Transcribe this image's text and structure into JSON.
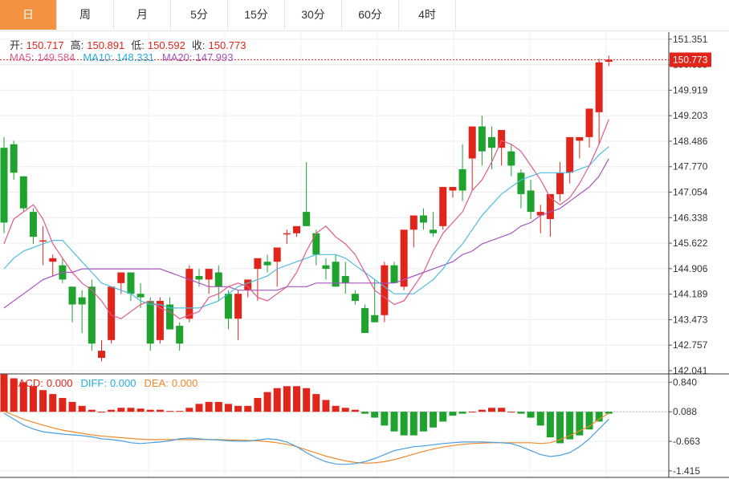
{
  "tabs": [
    {
      "label": "日",
      "active": true
    },
    {
      "label": "周",
      "active": false
    },
    {
      "label": "月",
      "active": false
    },
    {
      "label": "5分",
      "active": false
    },
    {
      "label": "15分",
      "active": false
    },
    {
      "label": "30分",
      "active": false
    },
    {
      "label": "60分",
      "active": false
    },
    {
      "label": "4时",
      "active": false
    }
  ],
  "ohlc": {
    "open_label": "开:",
    "open": "150.717",
    "high_label": "高:",
    "high": "150.891",
    "low_label": "低:",
    "low": "150.592",
    "close_label": "收:",
    "close": "150.773"
  },
  "ma": {
    "ma5_label": "MA5:",
    "ma5": "149.584",
    "ma10_label": "MA10:",
    "ma10": "148.331",
    "ma20_label": "MA20:",
    "ma20": "147.993"
  },
  "macd": {
    "macd_label": "MACD:",
    "macd": "0.000",
    "diff_label": "DIFF:",
    "diff": "0.000",
    "dea_label": "DEA:",
    "dea": "0.000"
  },
  "colors": {
    "up": "#e0251b",
    "down": "#1fa22e",
    "ma5": "#e05a8a",
    "ma10": "#4cbde0",
    "ma20": "#a555c0",
    "diff": "#4a9fe0",
    "dea": "#f08a2a",
    "accent": "#f39240"
  },
  "chart_data": [
    {
      "type": "candlestick",
      "y_ticks": [
        "151.351",
        "150.635",
        "149.919",
        "149.203",
        "148.486",
        "147.770",
        "147.054",
        "146.338",
        "145.622",
        "144.906",
        "144.189",
        "143.473",
        "142.757",
        "142.041"
      ],
      "ylim": [
        141.95,
        151.55
      ],
      "last_price": "150.773",
      "candles": [
        [
          148.3,
          148.6,
          145.9,
          146.2
        ],
        [
          148.4,
          148.5,
          147.4,
          147.6
        ],
        [
          147.5,
          147.5,
          146.5,
          146.6
        ],
        [
          146.5,
          146.6,
          145.6,
          145.8
        ],
        [
          145.7,
          146.1,
          145.0,
          145.7
        ],
        [
          145.1,
          145.3,
          144.7,
          145.2
        ],
        [
          145.0,
          145.2,
          144.5,
          144.6
        ],
        [
          144.4,
          144.4,
          143.4,
          143.9
        ],
        [
          144.1,
          144.3,
          143.1,
          143.9
        ],
        [
          144.4,
          144.6,
          142.6,
          142.8
        ],
        [
          142.4,
          142.9,
          142.3,
          142.6
        ],
        [
          142.9,
          144.3,
          142.8,
          144.4
        ],
        [
          144.5,
          144.6,
          144.2,
          144.8
        ],
        [
          144.8,
          144.8,
          144.0,
          144.2
        ],
        [
          144.2,
          144.5,
          143.8,
          144.1
        ],
        [
          144.0,
          144.1,
          142.6,
          142.8
        ],
        [
          142.9,
          144.1,
          142.8,
          144.0
        ],
        [
          143.9,
          144.1,
          143.2,
          143.2
        ],
        [
          143.3,
          143.4,
          142.6,
          142.8
        ],
        [
          143.5,
          145.0,
          143.4,
          144.9
        ],
        [
          144.7,
          144.9,
          144.4,
          144.6
        ],
        [
          144.6,
          144.9,
          144.2,
          144.9
        ],
        [
          144.8,
          145.0,
          144.0,
          144.4
        ],
        [
          144.2,
          144.3,
          143.2,
          143.5
        ],
        [
          143.5,
          144.3,
          142.9,
          144.2
        ],
        [
          144.3,
          144.6,
          144.1,
          144.6
        ],
        [
          144.9,
          145.0,
          144.0,
          145.2
        ],
        [
          145.1,
          145.3,
          144.8,
          145.0
        ],
        [
          145.1,
          145.3,
          144.4,
          145.5
        ],
        [
          145.9,
          146.0,
          145.6,
          145.9
        ],
        [
          145.9,
          146.1,
          145.8,
          146.1
        ],
        [
          146.5,
          147.9,
          146.3,
          146.1
        ],
        [
          145.9,
          146.0,
          145.0,
          145.3
        ],
        [
          145.0,
          145.2,
          144.6,
          144.9
        ],
        [
          145.1,
          145.3,
          144.6,
          144.4
        ],
        [
          144.7,
          145.1,
          144.2,
          144.5
        ],
        [
          144.2,
          144.3,
          143.9,
          144.0
        ],
        [
          143.8,
          143.9,
          143.1,
          143.1
        ],
        [
          143.6,
          144.6,
          143.4,
          143.4
        ],
        [
          143.6,
          145.1,
          143.4,
          145.0
        ],
        [
          145.0,
          145.1,
          144.6,
          144.5
        ],
        [
          144.4,
          145.8,
          144.3,
          146.0
        ],
        [
          146.0,
          146.4,
          145.5,
          146.4
        ],
        [
          146.4,
          146.6,
          146.0,
          146.2
        ],
        [
          146.0,
          146.5,
          145.8,
          145.9
        ],
        [
          146.1,
          147.2,
          146.0,
          147.2
        ],
        [
          147.1,
          147.1,
          146.9,
          147.2
        ],
        [
          147.7,
          148.4,
          146.8,
          147.1
        ],
        [
          148.0,
          148.0,
          147.1,
          148.9
        ],
        [
          148.9,
          149.2,
          147.8,
          148.2
        ],
        [
          148.6,
          148.9,
          147.7,
          148.3
        ],
        [
          148.3,
          148.6,
          147.8,
          148.8
        ],
        [
          148.2,
          148.4,
          147.5,
          147.8
        ],
        [
          147.6,
          147.7,
          146.6,
          147.0
        ],
        [
          147.1,
          147.4,
          146.3,
          146.5
        ],
        [
          146.4,
          146.7,
          145.9,
          146.5
        ],
        [
          146.3,
          146.9,
          145.8,
          147.0
        ],
        [
          147.0,
          147.9,
          146.8,
          147.6
        ],
        [
          147.6,
          148.4,
          147.3,
          148.6
        ],
        [
          148.5,
          148.6,
          148.0,
          148.6
        ],
        [
          148.6,
          149.4,
          148.3,
          149.4
        ],
        [
          149.3,
          150.8,
          148.4,
          150.7
        ],
        [
          150.717,
          150.891,
          150.592,
          150.773
        ]
      ],
      "ma5": [
        145.6,
        146.3,
        146.5,
        146.7,
        146.3,
        145.6,
        145.2,
        144.8,
        144.5,
        144.3,
        144.0,
        143.6,
        143.5,
        143.7,
        143.9,
        144.0,
        143.8,
        143.7,
        143.5,
        143.6,
        143.7,
        144.1,
        144.2,
        144.4,
        144.5,
        144.4,
        144.1,
        144.0,
        144.2,
        144.4,
        144.8,
        145.4,
        145.9,
        146.1,
        145.8,
        145.6,
        145.3,
        144.8,
        144.3,
        144.1,
        143.9,
        144.0,
        144.4,
        144.8,
        145.4,
        145.9,
        146.2,
        146.5,
        147.1,
        147.4,
        147.9,
        148.5,
        148.4,
        148.2,
        147.8,
        147.4,
        146.9,
        146.7,
        146.9,
        147.3,
        147.8,
        148.4,
        149.1
      ],
      "ma10": [
        144.9,
        145.2,
        145.4,
        145.5,
        145.6,
        145.7,
        145.7,
        145.4,
        145.1,
        144.8,
        144.5,
        144.4,
        144.3,
        144.2,
        144.0,
        143.9,
        143.9,
        143.8,
        143.8,
        143.8,
        143.8,
        143.9,
        144.0,
        144.2,
        144.4,
        144.5,
        144.6,
        144.7,
        144.9,
        145.0,
        145.1,
        145.2,
        145.3,
        145.3,
        145.3,
        145.2,
        145.0,
        144.8,
        144.6,
        144.4,
        144.2,
        144.2,
        144.2,
        144.4,
        144.6,
        144.9,
        145.3,
        145.6,
        146.0,
        146.4,
        146.7,
        147.0,
        147.2,
        147.4,
        147.5,
        147.6,
        147.6,
        147.6,
        147.6,
        147.7,
        147.8,
        148.1,
        148.331
      ],
      "ma20": [
        143.8,
        144.0,
        144.2,
        144.4,
        144.6,
        144.7,
        144.8,
        144.8,
        144.9,
        144.9,
        144.9,
        144.9,
        144.9,
        144.9,
        144.9,
        144.9,
        144.9,
        144.8,
        144.7,
        144.6,
        144.5,
        144.4,
        144.4,
        144.4,
        144.3,
        144.3,
        144.3,
        144.3,
        144.3,
        144.4,
        144.4,
        144.4,
        144.5,
        144.5,
        144.5,
        144.5,
        144.5,
        144.5,
        144.5,
        144.5,
        144.5,
        144.6,
        144.7,
        144.8,
        144.9,
        145.0,
        145.1,
        145.3,
        145.4,
        145.6,
        145.7,
        145.8,
        145.9,
        146.1,
        146.2,
        146.4,
        146.5,
        146.6,
        146.8,
        147.0,
        147.2,
        147.5,
        147.993
      ]
    },
    {
      "type": "macd",
      "y_ticks": [
        "0.840",
        "0.088",
        "-0.663",
        "-1.415"
      ],
      "ylim": [
        -1.58,
        1.05
      ],
      "hist": [
        0.95,
        0.85,
        0.75,
        0.65,
        0.55,
        0.45,
        0.35,
        0.25,
        0.15,
        0.05,
        0.0,
        0.05,
        0.1,
        0.1,
        0.08,
        0.05,
        0.05,
        0.02,
        0.02,
        0.1,
        0.2,
        0.25,
        0.25,
        0.2,
        0.15,
        0.15,
        0.35,
        0.5,
        0.6,
        0.65,
        0.65,
        0.6,
        0.45,
        0.3,
        0.15,
        0.1,
        0.05,
        -0.05,
        -0.15,
        -0.35,
        -0.5,
        -0.6,
        -0.6,
        -0.5,
        -0.4,
        -0.25,
        -0.1,
        -0.05,
        0.0,
        0.05,
        0.1,
        0.1,
        0.0,
        -0.05,
        -0.15,
        -0.35,
        -0.65,
        -0.8,
        -0.7,
        -0.6,
        -0.45,
        -0.25,
        -0.05
      ],
      "diff": [
        0.05,
        -0.1,
        -0.25,
        -0.35,
        -0.42,
        -0.45,
        -0.48,
        -0.5,
        -0.52,
        -0.55,
        -0.6,
        -0.62,
        -0.65,
        -0.7,
        -0.72,
        -0.7,
        -0.68,
        -0.65,
        -0.6,
        -0.58,
        -0.6,
        -0.62,
        -0.63,
        -0.65,
        -0.66,
        -0.66,
        -0.63,
        -0.6,
        -0.62,
        -0.68,
        -0.8,
        -0.95,
        -1.08,
        -1.18,
        -1.24,
        -1.25,
        -1.23,
        -1.18,
        -1.1,
        -1.0,
        -0.9,
        -0.85,
        -0.8,
        -0.78,
        -0.75,
        -0.72,
        -0.7,
        -0.68,
        -0.68,
        -0.68,
        -0.69,
        -0.7,
        -0.72,
        -0.8,
        -0.9,
        -1.0,
        -1.05,
        -1.02,
        -0.95,
        -0.8,
        -0.6,
        -0.35,
        -0.1
      ],
      "dea": [
        0.1,
        0.0,
        -0.1,
        -0.18,
        -0.25,
        -0.32,
        -0.38,
        -0.42,
        -0.46,
        -0.5,
        -0.53,
        -0.55,
        -0.57,
        -0.59,
        -0.61,
        -0.62,
        -0.62,
        -0.62,
        -0.62,
        -0.62,
        -0.62,
        -0.62,
        -0.62,
        -0.63,
        -0.63,
        -0.64,
        -0.65,
        -0.67,
        -0.7,
        -0.74,
        -0.8,
        -0.88,
        -0.96,
        -1.04,
        -1.1,
        -1.16,
        -1.2,
        -1.22,
        -1.21,
        -1.18,
        -1.13,
        -1.06,
        -0.99,
        -0.92,
        -0.86,
        -0.81,
        -0.77,
        -0.74,
        -0.72,
        -0.71,
        -0.7,
        -0.7,
        -0.7,
        -0.7,
        -0.7,
        -0.72,
        -0.7,
        -0.62,
        -0.52,
        -0.4,
        -0.28,
        -0.1,
        0.05
      ]
    }
  ]
}
